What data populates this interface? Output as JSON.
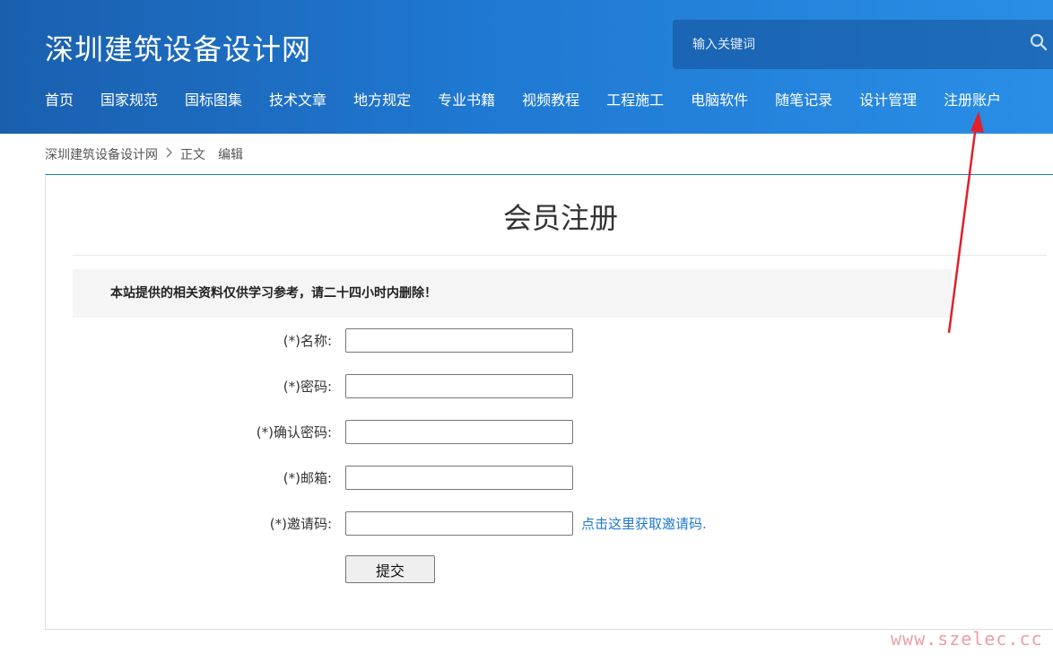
{
  "header": {
    "site_title": "深圳建筑设备设计网",
    "search_placeholder": "输入关键词",
    "nav": [
      "首页",
      "国家规范",
      "国标图集",
      "技术文章",
      "地方规定",
      "专业书籍",
      "视频教程",
      "工程施工",
      "电脑软件",
      "随笔记录",
      "设计管理",
      "注册账户"
    ]
  },
  "breadcrumb": {
    "home": "深圳建筑设备设计网",
    "separator": ">",
    "current": "正文",
    "edit": "编辑"
  },
  "main": {
    "page_title": "会员注册",
    "notice": "本站提供的相关资料仅供学习参考，请二十四小时内删除！",
    "fields": [
      {
        "label": "(*)名称:",
        "value": ""
      },
      {
        "label": "(*)密码:",
        "value": ""
      },
      {
        "label": "(*)确认密码:",
        "value": ""
      },
      {
        "label": "(*)邮箱:",
        "value": ""
      },
      {
        "label": "(*)邀请码:",
        "value": ""
      }
    ],
    "invite_link": "点击这里获取邀请码.",
    "submit_label": "提交"
  },
  "watermark": "www.szelec.cc",
  "colors": {
    "header_start": "#1a5fae",
    "header_end": "#2a8ee6",
    "link": "#1f78d1",
    "annotation_arrow": "#e0202a"
  },
  "icons": {
    "search": "search-icon",
    "arrow": "annotation-arrow"
  }
}
